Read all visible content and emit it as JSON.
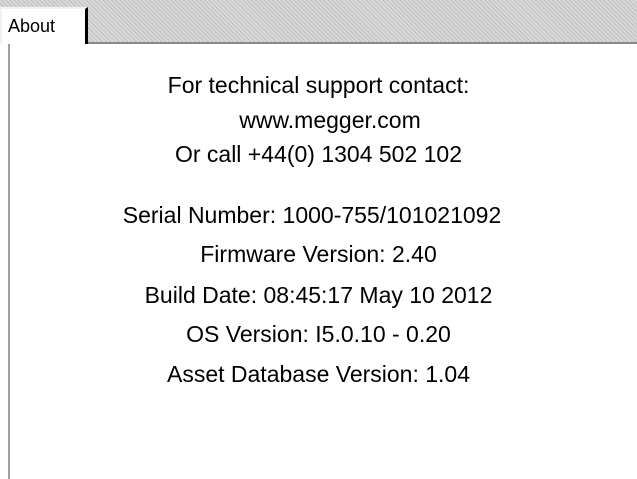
{
  "tabs": [
    {
      "label": "About",
      "active": true
    }
  ],
  "support": {
    "heading": "For technical support contact:",
    "website": "www.megger.com",
    "phone_line": "Or call +44(0) 1304 502 102"
  },
  "info": {
    "serial_number": "Serial Number:  1000-755/101021092",
    "firmware_version": "Firmware Version:   2.40",
    "build_date": "Build Date:  08:45:17 May 10 2012",
    "os_version": "OS Version:  I5.0.10 - 0.20",
    "asset_database_version": "Asset Database Version:  1.04"
  },
  "colors": {
    "background": "#ffffff",
    "text": "#000000",
    "tab_strip": "#d8d8d8"
  }
}
